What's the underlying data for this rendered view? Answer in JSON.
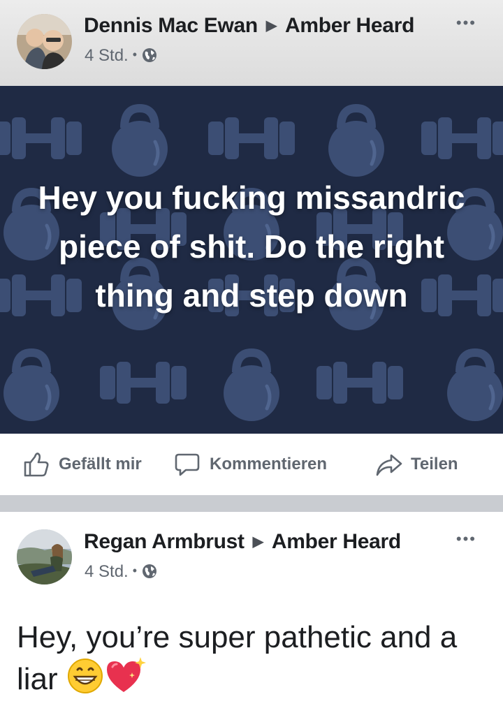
{
  "post1": {
    "author": "Dennis Mac Ewan",
    "target": "Amber Heard",
    "time": "4 Std.",
    "more": "•••",
    "text": "Hey you fucking missandric piece of shit. Do the right thing and step down",
    "background_color": "#1f2a44"
  },
  "actions": {
    "like_label": "Gefällt mir",
    "comment_label": "Kommentieren",
    "share_label": "Teilen"
  },
  "post2": {
    "author": "Regan Armbrust",
    "target": "Amber Heard",
    "time": "4 Std.",
    "more": "•••",
    "text": "Hey, you’re super pathetic and a liar",
    "emojis": [
      "grinning-face-emoji",
      "sparkling-heart-emoji"
    ]
  },
  "icons": {
    "privacy": "globe-icon",
    "arrow": "triangle-right-icon",
    "like": "thumbs-up-icon",
    "comment": "comment-bubble-icon",
    "share": "share-arrow-icon"
  }
}
